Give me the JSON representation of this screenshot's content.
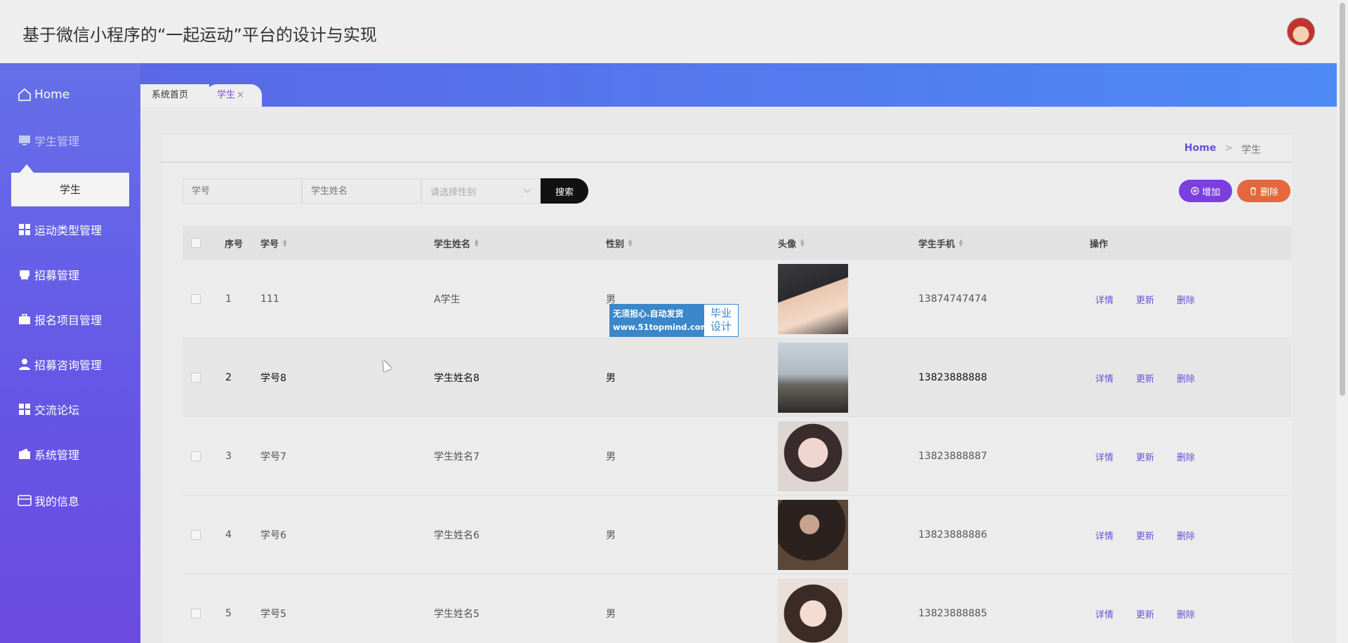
{
  "header": {
    "title": "基于微信小程序的“一起运动”平台的设计与实现"
  },
  "sidebar": {
    "home": "Home",
    "student_mgmt": "学生管理",
    "student_sub": "学生",
    "items": [
      {
        "label": "运动类型管理",
        "icon": "grid-icon"
      },
      {
        "label": "招募管理",
        "icon": "printer-icon"
      },
      {
        "label": "报名项目管理",
        "icon": "briefcase-icon"
      },
      {
        "label": "招募咨询管理",
        "icon": "user-icon"
      },
      {
        "label": "交流论坛",
        "icon": "grid-icon"
      },
      {
        "label": "系统管理",
        "icon": "wallet-icon"
      },
      {
        "label": "我的信息",
        "icon": "card-icon"
      }
    ]
  },
  "tabs": {
    "home": "系统首页",
    "student": "学生",
    "close": "×"
  },
  "breadcrumb": {
    "home": "Home",
    "sep": ">",
    "current": "学生"
  },
  "search": {
    "id_placeholder": "学号",
    "name_placeholder": "学生姓名",
    "gender_placeholder": "请选择性别",
    "button": "搜索"
  },
  "actions": {
    "add": "增加",
    "delete": "删除"
  },
  "table": {
    "headers": {
      "index": "序号",
      "id": "学号",
      "name": "学生姓名",
      "gender": "性别",
      "avatar": "头像",
      "phone": "学生手机",
      "ops": "操作"
    },
    "ops": {
      "detail": "详情",
      "update": "更新",
      "delete": "删除"
    },
    "rows": [
      {
        "index": "1",
        "id": "111",
        "name": "A学生",
        "gender": "男",
        "phone": "13874747474"
      },
      {
        "index": "2",
        "id": "学号8",
        "name": "学生姓名8",
        "gender": "男",
        "phone": "13823888888"
      },
      {
        "index": "3",
        "id": "学号7",
        "name": "学生姓名7",
        "gender": "男",
        "phone": "13823888887"
      },
      {
        "index": "4",
        "id": "学号6",
        "name": "学生姓名6",
        "gender": "男",
        "phone": "13823888886"
      },
      {
        "index": "5",
        "id": "学号5",
        "name": "学生姓名5",
        "gender": "男",
        "phone": "13823888885"
      }
    ]
  },
  "watermark": {
    "line1": "无须担心.自动发货",
    "line2": "www.51topmind.com",
    "right1": "毕业",
    "right2": "设计"
  },
  "colors": {
    "accent": "#6b4fd8",
    "add": "#7b3fe0",
    "delete": "#e4683b",
    "sidebar_top": "#6470e8",
    "sidebar_bottom": "#6a4ae0"
  }
}
